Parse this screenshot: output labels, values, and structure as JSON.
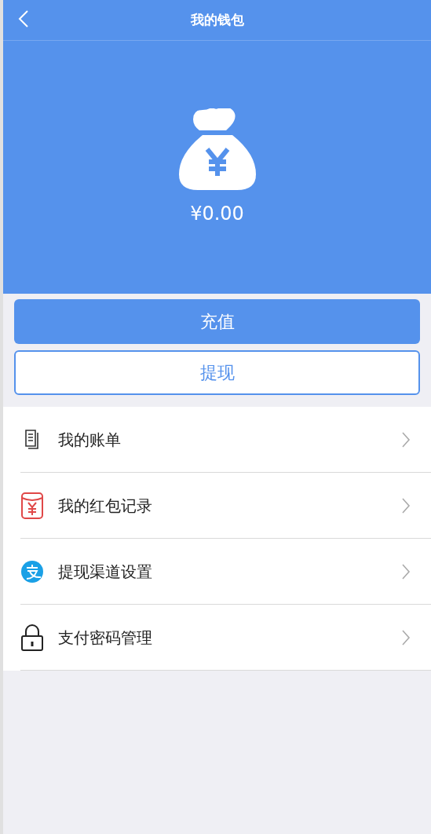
{
  "header": {
    "title": "我的钱包"
  },
  "balance": "¥0.00",
  "buttons": [
    {
      "label": "充值",
      "kind": "primary"
    },
    {
      "label": "提现",
      "kind": "outline"
    }
  ],
  "menu": [
    {
      "label": "我的账单",
      "kind": "bill"
    },
    {
      "label": "我的红包记录",
      "kind": "red-packet"
    },
    {
      "label": "提现渠道设置",
      "kind": "alipay"
    },
    {
      "label": "支付密码管理",
      "kind": "lock"
    }
  ]
}
